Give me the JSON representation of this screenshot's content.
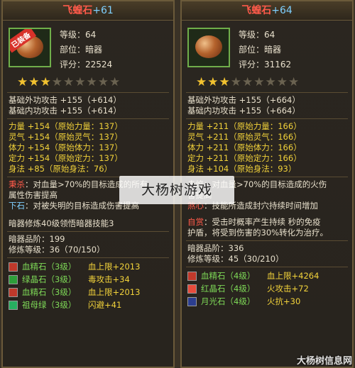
{
  "left": {
    "title": "飞蝗石",
    "plus": "+61",
    "equipped_tag": "已装备",
    "meta": [
      "等级：64",
      "部位：暗器",
      "评分：22524"
    ],
    "stars_filled": 3,
    "stars_total": 9,
    "base": [
      "基础外功攻击 +155（+614）",
      "基础内功攻击 +155（+614）"
    ],
    "attrs": [
      "力量 +154（原始力量：137）",
      "灵气 +154（原始灵气：137）",
      "体力 +154（原始体力：137）",
      "定力 +154（原始定力：137）",
      "身法 +85（原始身法：76）"
    ],
    "effects": [
      {
        "label": "秉杀",
        "text": "：对血量>70%的目标造成的所有"
      },
      {
        "label": "",
        "text": "属性伤害提高"
      },
      {
        "label": "下石",
        "text": "：对被失明的目标造成伤害提高"
      }
    ],
    "skill": "暗器修炼40级领悟暗器技能3",
    "grade": "暗器品阶：199",
    "cultivation": "修炼等级：36（70/150）",
    "gems": [
      {
        "name": "血精石（3级）",
        "bonus": "血上限+2013",
        "color": "#c0392b"
      },
      {
        "name": "绿晶石（3级）",
        "bonus": "毒攻击+34",
        "color": "#2e9e3a"
      },
      {
        "name": "血精石（3级）",
        "bonus": "血上限+2013",
        "color": "#c0392b"
      },
      {
        "name": "祖母绿（3级）",
        "bonus": "闪避+41",
        "color": "#27ae60"
      }
    ]
  },
  "right": {
    "title": "飞蝗石",
    "plus": "+64",
    "meta": [
      "等级：64",
      "部位：暗器",
      "评分：31162"
    ],
    "stars_filled": 3,
    "stars_total": 9,
    "base": [
      "基础外功攻击 +155（+664）",
      "基础内功攻击 +155（+664）"
    ],
    "attrs": [
      "力量 +211（原始力量：166）",
      "灵气 +211（原始灵气：166）",
      "体力 +211（原始体力：166）",
      "定力 +211（原始定力：166）",
      "身法 +104（原始身法：93）"
    ],
    "effects": [
      {
        "label": "",
        "text": "赤焰：对血量>70%的目标造成的火伤"
      },
      {
        "label": "",
        "text": "害提高"
      },
      {
        "label": "煞心",
        "text": "：技能所造成封穴持续时间增加"
      },
      {
        "label": "",
        "text": ""
      },
      {
        "label": "自赏",
        "text": "：受击时概率产生持续  秒的免疫"
      },
      {
        "label": "",
        "text": "护盾，将受到伤害的30%转化为治疗。"
      }
    ],
    "grade": "暗器品阶：336",
    "cultivation": "修炼等级：45（30/210）",
    "gems": [
      {
        "name": "血精石（4级）",
        "bonus": "血上限+4264",
        "color": "#c0392b"
      },
      {
        "name": "红晶石（4级）",
        "bonus": "火攻击+72",
        "color": "#e74c3c"
      },
      {
        "name": "月光石（4级）",
        "bonus": "火抗+30",
        "color": "#2c3e8f"
      }
    ]
  },
  "watermark": "大杨树游戏",
  "corner_mark": "大杨树信息网",
  "colors": {
    "red": "#ff5a4a",
    "blue": "#7fd0ff",
    "yellow": "#f2d23a",
    "green": "#7ed957"
  }
}
